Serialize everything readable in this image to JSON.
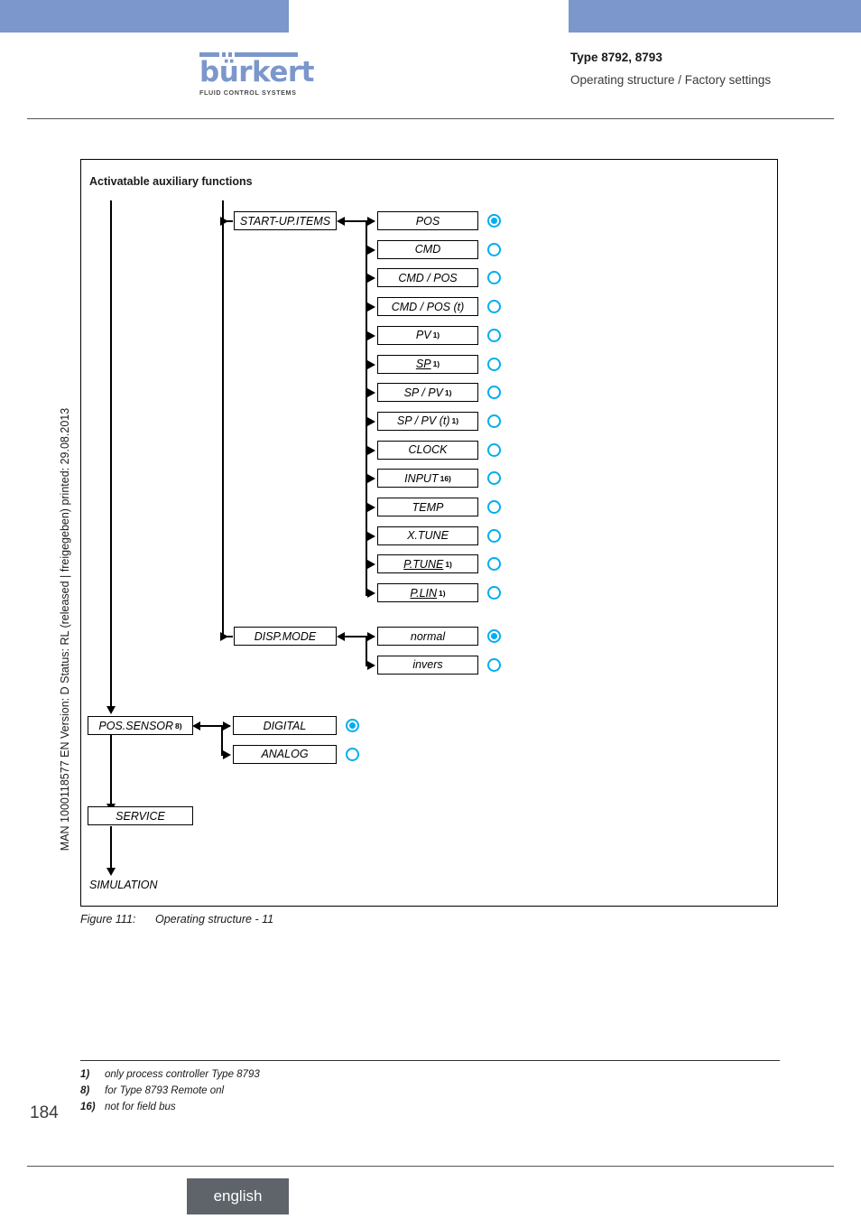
{
  "header": {
    "title": "Type 8792, 8793",
    "subtitle": "Operating structure / Factory settings",
    "logo_word": "bürkert",
    "logo_sub": "FLUID CONTROL SYSTEMS",
    "bar_color": "#7b97cb"
  },
  "side_text": "MAN 1000118577  EN  Version: D  Status: RL (released | freigegeben)  printed: 29.08.2013",
  "figure": {
    "title": "Activatable auxiliary functions",
    "caption_number": "Figure 111:",
    "caption_text": "Operating structure - 11",
    "accent_color": "#00aeef",
    "menus": [
      {
        "label": "START-UP.ITEMS",
        "sup": "",
        "underline": false
      },
      {
        "label": "DISP.MODE",
        "sup": "",
        "underline": false
      },
      {
        "label": "POS.SENSOR",
        "sup": "8)",
        "underline": false
      },
      {
        "label": "SERVICE",
        "sup": "",
        "underline": false
      },
      {
        "label": "SIMULATION",
        "sup": "",
        "underline": false
      }
    ],
    "startup_items": [
      {
        "label": "POS",
        "sup": "",
        "underline": false,
        "selected": true
      },
      {
        "label": "CMD",
        "sup": "",
        "underline": false,
        "selected": false
      },
      {
        "label": "CMD / POS",
        "sup": "",
        "underline": false,
        "selected": false
      },
      {
        "label": "CMD / POS (t)",
        "sup": "",
        "underline": false,
        "selected": false
      },
      {
        "label": "PV",
        "sup": "1)",
        "underline": false,
        "selected": false
      },
      {
        "label": "SP",
        "sup": "1)",
        "underline": true,
        "selected": false
      },
      {
        "label": "SP / PV",
        "sup": "1)",
        "underline": false,
        "selected": false
      },
      {
        "label": "SP / PV (t)",
        "sup": "1)",
        "underline": false,
        "selected": false
      },
      {
        "label": "CLOCK",
        "sup": "",
        "underline": false,
        "selected": false
      },
      {
        "label": "INPUT",
        "sup": "16)",
        "underline": false,
        "selected": false
      },
      {
        "label": "TEMP",
        "sup": "",
        "underline": false,
        "selected": false
      },
      {
        "label": "X.TUNE",
        "sup": "",
        "underline": false,
        "selected": false
      },
      {
        "label": "P.TUNE",
        "sup": "1)",
        "underline": true,
        "selected": false
      },
      {
        "label": "P.LIN",
        "sup": "1)",
        "underline": true,
        "selected": false
      }
    ],
    "disp_mode_items": [
      {
        "label": "normal",
        "sup": "",
        "underline": false,
        "selected": true
      },
      {
        "label": "invers",
        "sup": "",
        "underline": false,
        "selected": false
      }
    ],
    "pos_sensor_items": [
      {
        "label": "DIGITAL",
        "sup": "",
        "underline": false,
        "selected": true
      },
      {
        "label": "ANALOG",
        "sup": "",
        "underline": false,
        "selected": false
      }
    ]
  },
  "footnotes": [
    {
      "key": "1)",
      "text": "only process controller Type 8793"
    },
    {
      "key": "8)",
      "text": "for Type 8793 Remote onl"
    },
    {
      "key": "16)",
      "text": "not for field bus"
    }
  ],
  "page_number": "184",
  "language_tab": "english"
}
